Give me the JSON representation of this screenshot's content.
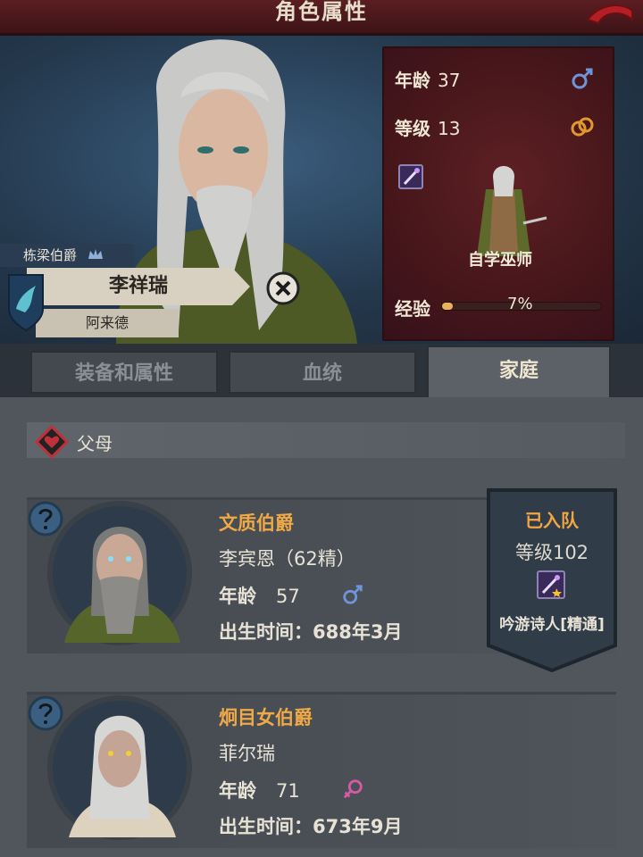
{
  "header": {
    "title": "角色属性"
  },
  "character": {
    "title": "栋梁伯爵",
    "name": "李祥瑞",
    "sub_name": "阿来德",
    "class": "自学巫师"
  },
  "stats": {
    "age_label": "年龄",
    "age": "37",
    "level_label": "等级",
    "level": "13",
    "exp_label": "经验",
    "exp_percent": "7%",
    "exp_fraction": 0.07
  },
  "tabs": [
    {
      "label": "装备和属性"
    },
    {
      "label": "血统"
    },
    {
      "label": "家庭"
    }
  ],
  "family": {
    "section_title": "父母",
    "members": [
      {
        "title": "文质伯爵",
        "name": "李宾恩（62精）",
        "age_label": "年龄",
        "age": "57",
        "birth": "出生时间：688年3月",
        "gender": "male"
      },
      {
        "title": "炯目女伯爵",
        "name": "菲尔瑞",
        "age_label": "年龄",
        "age": "71",
        "birth": "出生时间：673年9月",
        "gender": "female"
      }
    ]
  },
  "party_banner": {
    "status": "已入队",
    "level": "等级102",
    "class": "吟游诗人[精通]"
  },
  "colors": {
    "accent_orange": "#efa946",
    "male": "#6f95d8",
    "female": "#d85aa6",
    "header": "#5b1e22"
  },
  "icons": [
    "back-arrow-icon",
    "male-icon",
    "ring-icon",
    "wand-skill-icon",
    "crown-icon",
    "dragon-shield-icon",
    "close-icon",
    "heart-icon",
    "help-icon",
    "female-icon"
  ]
}
